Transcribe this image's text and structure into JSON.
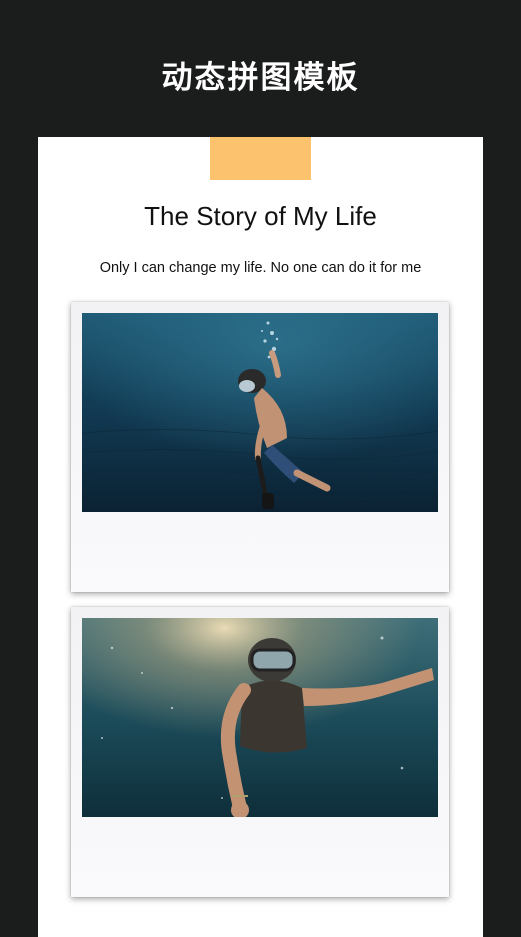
{
  "header": {
    "title": "动态拼图模板"
  },
  "template": {
    "title": "The Story of My Life",
    "subtitle": "Only I can change my life. No one can do it for me"
  },
  "photos": [
    {
      "name": "underwater-swimmer-selfie-stick"
    },
    {
      "name": "underwater-diver-mask-closeup"
    }
  ],
  "colors": {
    "background": "#1a1d1c",
    "tape": "#fdc26e",
    "card": "#ffffff"
  }
}
